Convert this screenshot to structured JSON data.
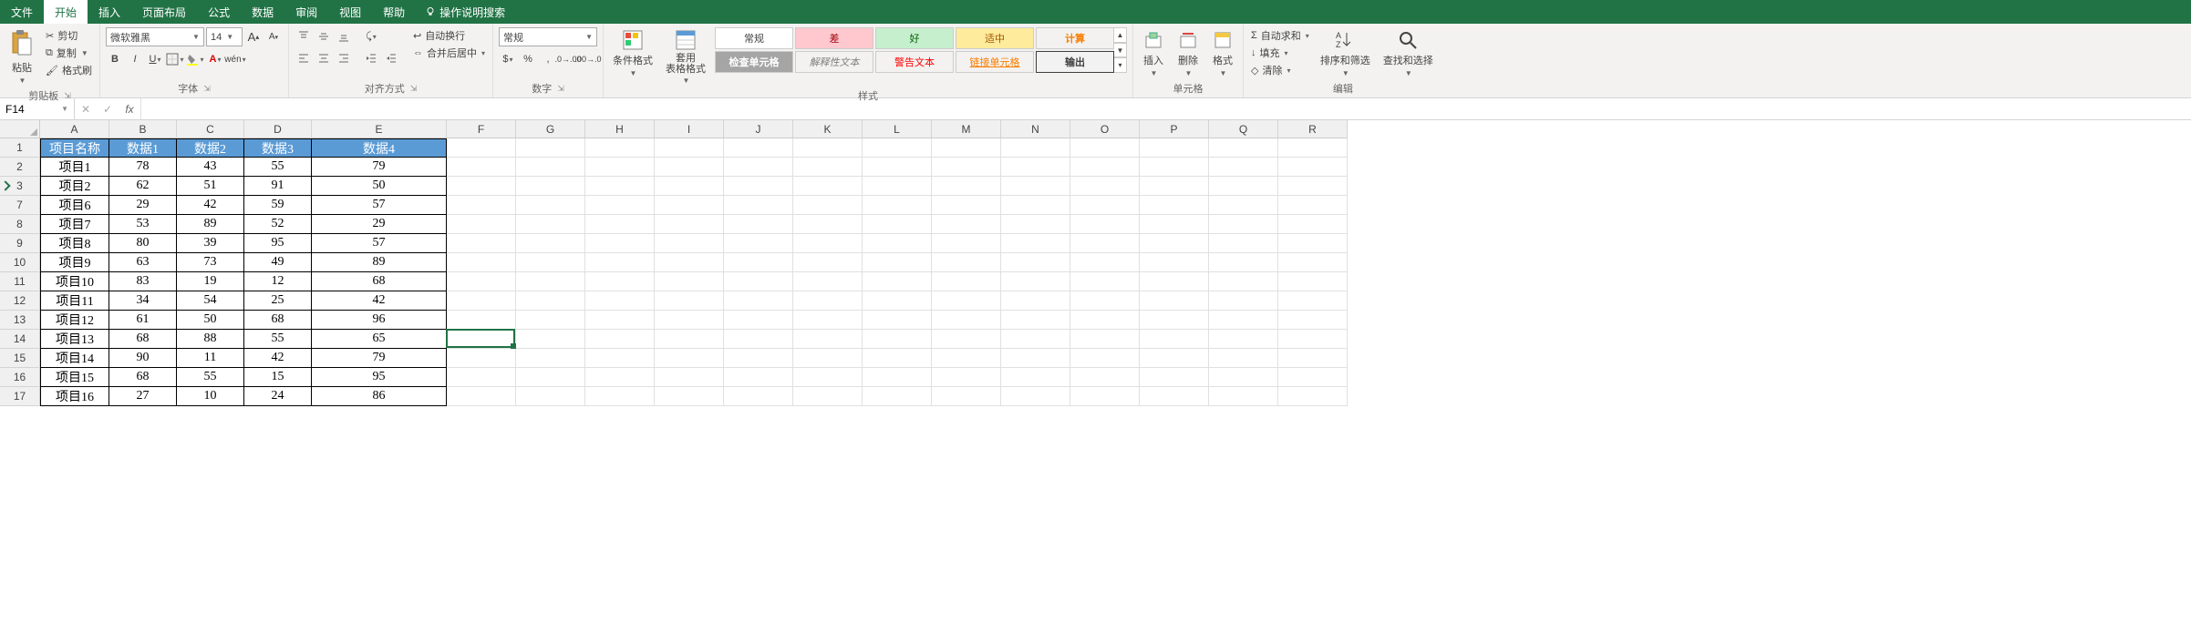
{
  "menu": {
    "tabs": [
      "文件",
      "开始",
      "插入",
      "页面布局",
      "公式",
      "数据",
      "审阅",
      "视图",
      "帮助"
    ],
    "active": 1,
    "help_search": "操作说明搜索"
  },
  "ribbon": {
    "clipboard": {
      "paste": "粘贴",
      "cut": "剪切",
      "copy": "复制",
      "painter": "格式刷",
      "label": "剪贴板"
    },
    "font": {
      "name": "微软雅黑",
      "size": "14",
      "label": "字体"
    },
    "align": {
      "wrap": "自动换行",
      "merge": "合并后居中",
      "label": "对齐方式"
    },
    "number": {
      "format": "常规",
      "label": "数字"
    },
    "styles": {
      "cond": "条件格式",
      "table": "套用\n表格格式",
      "cells": [
        "常规",
        "差",
        "好",
        "适中",
        "检查单元格",
        "解释性文本",
        "警告文本",
        "链接单元格",
        "计算",
        "输出"
      ],
      "label": "样式"
    },
    "cells_grp": {
      "insert": "插入",
      "delete": "删除",
      "format": "格式",
      "label": "单元格"
    },
    "editing": {
      "sum": "自动求和",
      "fill": "填充",
      "clear": "清除",
      "sort": "排序和筛选",
      "find": "查找和选择",
      "label": "编辑"
    }
  },
  "formula_bar": {
    "namebox": "F14",
    "fx": "fx",
    "value": ""
  },
  "grid": {
    "columns": [
      "A",
      "B",
      "C",
      "D",
      "E",
      "F",
      "G",
      "H",
      "I",
      "J",
      "K",
      "L",
      "M",
      "N",
      "O",
      "P",
      "Q",
      "R"
    ],
    "col_widths": {
      "A": 76,
      "B": 74,
      "C": 74,
      "D": 74,
      "E": 148
    },
    "default_col_width": 76,
    "visible_row_numbers": [
      1,
      2,
      3,
      7,
      8,
      9,
      10,
      11,
      12,
      13,
      14,
      15,
      16,
      17
    ],
    "collapsed_after_row": 3,
    "headers": [
      "项目名称",
      "数据1",
      "数据2",
      "数据3",
      "数据4"
    ],
    "rows": [
      {
        "n": 2,
        "c": [
          "项目1",
          "78",
          "43",
          "55",
          "79"
        ]
      },
      {
        "n": 3,
        "c": [
          "项目2",
          "62",
          "51",
          "91",
          "50"
        ]
      },
      {
        "n": 7,
        "c": [
          "项目6",
          "29",
          "42",
          "59",
          "57"
        ]
      },
      {
        "n": 8,
        "c": [
          "项目7",
          "53",
          "89",
          "52",
          "29"
        ]
      },
      {
        "n": 9,
        "c": [
          "项目8",
          "80",
          "39",
          "95",
          "57"
        ]
      },
      {
        "n": 10,
        "c": [
          "项目9",
          "63",
          "73",
          "49",
          "89"
        ]
      },
      {
        "n": 11,
        "c": [
          "项目10",
          "83",
          "19",
          "12",
          "68"
        ]
      },
      {
        "n": 12,
        "c": [
          "项目11",
          "34",
          "54",
          "25",
          "42"
        ]
      },
      {
        "n": 13,
        "c": [
          "项目12",
          "61",
          "50",
          "68",
          "96"
        ]
      },
      {
        "n": 14,
        "c": [
          "项目13",
          "68",
          "88",
          "55",
          "65"
        ]
      },
      {
        "n": 15,
        "c": [
          "项目14",
          "90",
          "11",
          "42",
          "79"
        ]
      },
      {
        "n": 16,
        "c": [
          "项目15",
          "68",
          "55",
          "15",
          "95"
        ]
      },
      {
        "n": 17,
        "c": [
          "项目16",
          "27",
          "10",
          "24",
          "86"
        ]
      }
    ],
    "active_cell": "F14"
  }
}
